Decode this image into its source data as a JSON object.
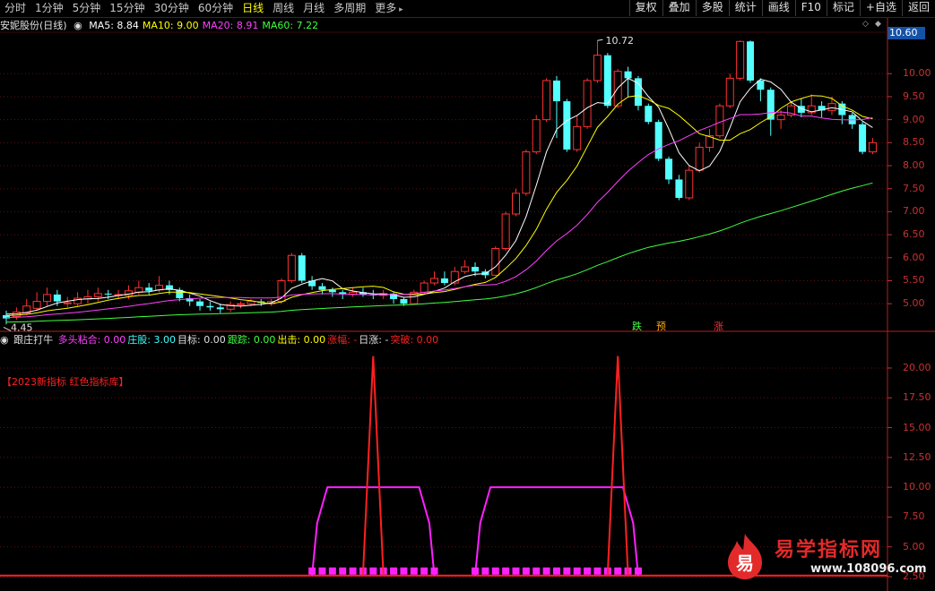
{
  "toolbar": {
    "periods": [
      "分时",
      "1分钟",
      "5分钟",
      "15分钟",
      "30分钟",
      "60分钟",
      "日线",
      "周线",
      "月线",
      "多周期",
      "更多"
    ],
    "active_period": "日线",
    "tools": [
      "复权",
      "叠加",
      "多股",
      "统计",
      "画线",
      "F10",
      "标记",
      "+自选",
      "返回"
    ]
  },
  "legend": {
    "stock_name": "安妮股份(日线)",
    "ma": [
      {
        "label": "MA5: 8.84",
        "color": "#ffffff"
      },
      {
        "label": "MA10: 9.00",
        "color": "#ffff00"
      },
      {
        "label": "MA20: 8.91",
        "color": "#ff40ff"
      },
      {
        "label": "MA60: 7.22",
        "color": "#40ff40"
      }
    ]
  },
  "indicator": {
    "name": "跟庄打牛",
    "items": [
      {
        "label": "多头粘合: 0.00",
        "color": "#ff40ff"
      },
      {
        "label": "庄股: 3.00",
        "color": "#40ffff"
      },
      {
        "label": "目标: 0.00",
        "color": "#e0e0e0"
      },
      {
        "label": "跟踪: 0.00",
        "color": "#40ff40"
      },
      {
        "label": "出击: 0.00",
        "color": "#ffff00"
      },
      {
        "label": "涨幅: -",
        "color": "#ff2020"
      },
      {
        "label": "日涨: -",
        "color": "#e0e0e0"
      },
      {
        "label": "突破: 0.00",
        "color": "#ff2020"
      }
    ],
    "promo": "【2023新指标 红色指标库】"
  },
  "price_tag": "10.60",
  "annotations": {
    "high": "10.72",
    "low": "4.45"
  },
  "signals": [
    {
      "text": "跌",
      "color": "#40ff40"
    },
    {
      "text": "预",
      "color": "#ffaa00"
    },
    {
      "text": "涨",
      "color": "#ff3030"
    }
  ],
  "main_axis": [
    "10.00",
    "9.50",
    "9.00",
    "8.50",
    "8.00",
    "7.50",
    "7.00",
    "6.50",
    "6.00",
    "5.50",
    "5.00"
  ],
  "sub_axis": [
    "20.00",
    "17.50",
    "15.00",
    "12.50",
    "10.00",
    "7.50",
    "5.00",
    "2.50"
  ],
  "watermark": {
    "logo_char": "易",
    "title": "易学指标网",
    "url": "www.108096.com"
  },
  "chart_data": [
    {
      "type": "candlestick",
      "title": "安妮股份(日线)",
      "ylim": [
        4.4,
        10.9
      ],
      "y_ticks": [
        5.0,
        5.5,
        6.0,
        6.5,
        7.0,
        7.5,
        8.0,
        8.5,
        9.0,
        9.5,
        10.0
      ],
      "high_label": 10.72,
      "low_label": 4.45,
      "last_price": 10.6,
      "candles_ohlc": [
        [
          4.75,
          4.68,
          4.85,
          4.55
        ],
        [
          4.72,
          4.82,
          4.92,
          4.65
        ],
        [
          4.8,
          4.95,
          5.1,
          4.75
        ],
        [
          4.9,
          5.05,
          5.25,
          4.85
        ],
        [
          5.05,
          5.2,
          5.35,
          4.95
        ],
        [
          5.2,
          5.05,
          5.3,
          4.95
        ],
        [
          5.0,
          5.02,
          5.15,
          4.92
        ],
        [
          5.0,
          5.12,
          5.25,
          4.95
        ],
        [
          5.1,
          5.15,
          5.3,
          5.0
        ],
        [
          5.15,
          5.22,
          5.35,
          5.05
        ],
        [
          5.22,
          5.2,
          5.3,
          5.1
        ],
        [
          5.2,
          5.2,
          5.3,
          5.1
        ],
        [
          5.18,
          5.28,
          5.4,
          5.1
        ],
        [
          5.25,
          5.35,
          5.5,
          5.2
        ],
        [
          5.35,
          5.28,
          5.45,
          5.2
        ],
        [
          5.3,
          5.4,
          5.6,
          5.25
        ],
        [
          5.4,
          5.3,
          5.5,
          5.2
        ],
        [
          5.3,
          5.12,
          5.35,
          5.05
        ],
        [
          5.12,
          5.05,
          5.2,
          4.95
        ],
        [
          5.05,
          4.95,
          5.1,
          4.85
        ],
        [
          4.95,
          4.92,
          5.05,
          4.85
        ],
        [
          4.92,
          4.88,
          5.0,
          4.8
        ],
        [
          4.88,
          4.98,
          5.05,
          4.82
        ],
        [
          4.98,
          5.0,
          5.05,
          4.9
        ],
        [
          5.0,
          5.05,
          5.1,
          4.95
        ],
        [
          5.05,
          5.02,
          5.1,
          4.95
        ],
        [
          5.0,
          5.05,
          5.1,
          4.95
        ],
        [
          5.05,
          5.5,
          5.55,
          5.0
        ],
        [
          5.5,
          6.05,
          6.1,
          5.45
        ],
        [
          6.05,
          5.5,
          6.1,
          5.45
        ],
        [
          5.5,
          5.38,
          5.6,
          5.3
        ],
        [
          5.38,
          5.3,
          5.45,
          5.2
        ],
        [
          5.3,
          5.25,
          5.35,
          5.15
        ],
        [
          5.25,
          5.2,
          5.3,
          5.1
        ],
        [
          5.2,
          5.25,
          5.35,
          5.15
        ],
        [
          5.25,
          5.2,
          5.35,
          5.15
        ],
        [
          5.2,
          5.18,
          5.3,
          5.1
        ],
        [
          5.18,
          5.22,
          5.3,
          5.1
        ],
        [
          5.22,
          5.1,
          5.25,
          5.0
        ],
        [
          5.1,
          5.0,
          5.15,
          4.95
        ],
        [
          5.0,
          5.25,
          5.3,
          4.98
        ],
        [
          5.25,
          5.45,
          5.5,
          5.2
        ],
        [
          5.45,
          5.55,
          5.7,
          5.4
        ],
        [
          5.55,
          5.45,
          5.7,
          5.4
        ],
        [
          5.45,
          5.7,
          5.8,
          5.4
        ],
        [
          5.7,
          5.8,
          5.95,
          5.65
        ],
        [
          5.8,
          5.7,
          5.9,
          5.6
        ],
        [
          5.7,
          5.62,
          5.75,
          5.55
        ],
        [
          5.62,
          6.2,
          6.25,
          5.6
        ],
        [
          6.2,
          6.95,
          7.0,
          6.15
        ],
        [
          6.95,
          7.4,
          7.5,
          6.9
        ],
        [
          7.4,
          8.3,
          8.35,
          7.35
        ],
        [
          8.3,
          9.0,
          9.1,
          8.25
        ],
        [
          9.0,
          9.85,
          9.9,
          8.95
        ],
        [
          9.85,
          9.4,
          9.95,
          8.6
        ],
        [
          9.4,
          8.35,
          9.45,
          8.3
        ],
        [
          8.35,
          8.85,
          9.1,
          8.3
        ],
        [
          8.85,
          9.85,
          9.9,
          8.8
        ],
        [
          9.85,
          10.4,
          10.72,
          9.8
        ],
        [
          10.4,
          9.3,
          10.45,
          9.25
        ],
        [
          9.3,
          10.05,
          10.1,
          9.25
        ],
        [
          10.05,
          9.9,
          10.15,
          9.5
        ],
        [
          9.9,
          9.3,
          9.95,
          9.2
        ],
        [
          9.3,
          8.95,
          9.35,
          8.9
        ],
        [
          8.95,
          8.15,
          9.0,
          8.1
        ],
        [
          8.15,
          7.7,
          8.2,
          7.6
        ],
        [
          7.7,
          7.3,
          7.8,
          7.25
        ],
        [
          7.3,
          7.9,
          8.0,
          7.25
        ],
        [
          7.9,
          8.4,
          8.5,
          7.85
        ],
        [
          8.4,
          8.65,
          8.8,
          8.3
        ],
        [
          8.65,
          9.3,
          9.35,
          8.6
        ],
        [
          9.3,
          9.9,
          10.0,
          9.25
        ],
        [
          9.9,
          10.7,
          10.72,
          9.85
        ],
        [
          10.7,
          9.85,
          10.72,
          9.8
        ],
        [
          9.85,
          9.65,
          9.9,
          9.4
        ],
        [
          9.65,
          9.0,
          9.7,
          8.65
        ],
        [
          9.0,
          9.1,
          9.2,
          8.8
        ],
        [
          9.1,
          9.3,
          9.4,
          9.05
        ],
        [
          9.3,
          9.15,
          9.45,
          9.05
        ],
        [
          9.15,
          9.3,
          9.55,
          9.1
        ],
        [
          9.3,
          9.2,
          9.4,
          9.05
        ],
        [
          9.2,
          9.35,
          9.5,
          9.1
        ],
        [
          9.35,
          9.1,
          9.4,
          8.9
        ],
        [
          9.1,
          8.9,
          9.15,
          8.8
        ],
        [
          8.9,
          8.3,
          8.95,
          8.25
        ],
        [
          8.3,
          8.5,
          8.6,
          8.25
        ]
      ],
      "series": [
        {
          "name": "MA5",
          "last": 8.84
        },
        {
          "name": "MA10",
          "last": 9.0
        },
        {
          "name": "MA20",
          "last": 8.91
        },
        {
          "name": "MA60",
          "last": 7.22
        }
      ]
    },
    {
      "type": "line",
      "title": "跟庄打牛",
      "ylim": [
        1.3,
        21.8
      ],
      "y_ticks": [
        2.5,
        5.0,
        7.5,
        10.0,
        12.5,
        15.0,
        17.5,
        20.0
      ],
      "series": [
        {
          "name": "多头粘合",
          "shapes": [
            [
              30.5,
              7.0
            ],
            [
              31.5,
              10.0
            ],
            [
              40.5,
              10.0
            ],
            [
              41.5,
              7.0
            ]
          ]
        },
        {
          "name": "庄股",
          "shapes": [
            [
              46.5,
              7.0
            ],
            [
              47.5,
              10.0
            ],
            [
              60.5,
              10.0
            ],
            [
              61.5,
              7.0
            ]
          ]
        },
        {
          "name": "突破",
          "spikes": [
            36,
            60
          ],
          "spike_value": 21.0
        }
      ]
    }
  ]
}
